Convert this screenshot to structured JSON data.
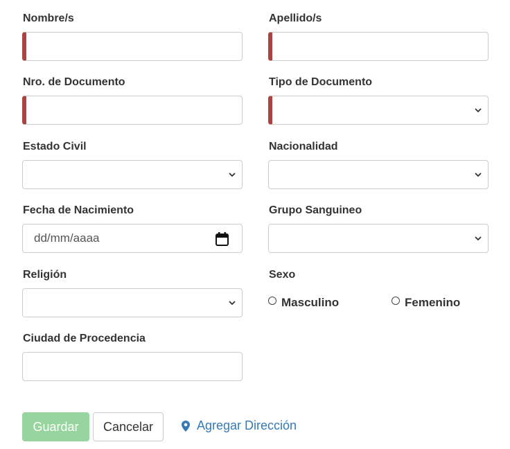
{
  "form": {
    "fields": {
      "nombres": {
        "label": "Nombre/s",
        "value": ""
      },
      "apellidos": {
        "label": "Apellido/s",
        "value": ""
      },
      "nro_documento": {
        "label": "Nro. de Documento",
        "value": ""
      },
      "tipo_documento": {
        "label": "Tipo de Documento",
        "selected": ""
      },
      "estado_civil": {
        "label": "Estado Civil",
        "selected": ""
      },
      "nacionalidad": {
        "label": "Nacionalidad",
        "selected": ""
      },
      "fecha_nacimiento": {
        "label": "Fecha de Nacimiento",
        "placeholder": "dd/mm/aaaa"
      },
      "grupo_sanguineo": {
        "label": "Grupo Sanguineo",
        "selected": ""
      },
      "religion": {
        "label": "Religión",
        "selected": ""
      },
      "sexo": {
        "label": "Sexo",
        "options": [
          "Masculino",
          "Femenino"
        ]
      },
      "ciudad_procedencia": {
        "label": "Ciudad de Procedencia",
        "value": ""
      }
    },
    "actions": {
      "save_label": "Guardar",
      "cancel_label": "Cancelar",
      "add_address_label": "Agregar Dirección"
    }
  },
  "colors": {
    "required_marker": "#a94442",
    "save_button_disabled": "#97d49e",
    "link": "#337ab7",
    "border": "#cccccc"
  },
  "icons": {
    "select_chevron": "chevron-down-icon",
    "date_picker": "calendar-icon",
    "add_address": "map-marker-icon"
  }
}
